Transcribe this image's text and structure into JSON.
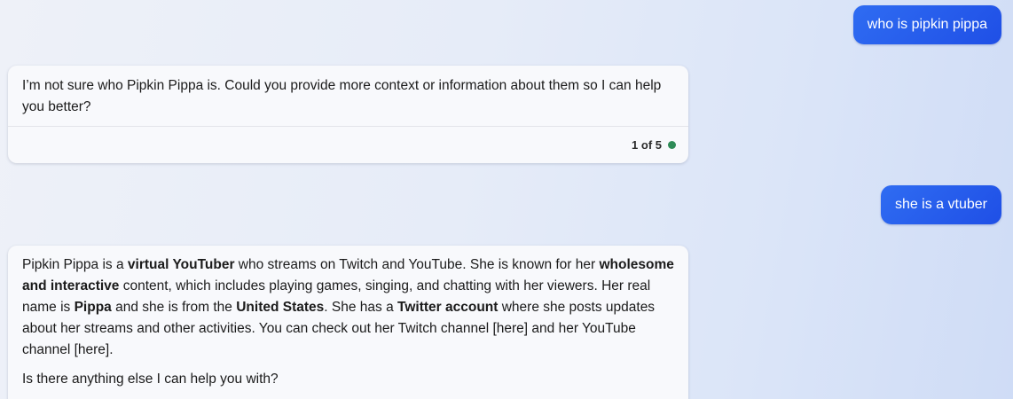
{
  "colors": {
    "user_bubble": "#2f6cf2",
    "status_dot": "#2e8b57"
  },
  "conversation": {
    "user_message_1": "who is pipkin pippa",
    "bot_message_1": {
      "text": "I’m not sure who Pipkin Pippa is. Could you provide more context or information about them so I can help you better?",
      "footer_counter": "1 of 5",
      "status_icon": "status-dot-icon"
    },
    "user_message_2": "she is a vtuber",
    "bot_message_2": {
      "paragraph_1": [
        {
          "t": "Pipkin Pippa is a ",
          "b": false
        },
        {
          "t": "virtual YouTuber",
          "b": true
        },
        {
          "t": " who streams on Twitch and YouTube. She is known for her ",
          "b": false
        },
        {
          "t": "wholesome and interactive",
          "b": true
        },
        {
          "t": " content, which includes playing games, singing, and chatting with her viewers. Her real name is ",
          "b": false
        },
        {
          "t": "Pippa",
          "b": true
        },
        {
          "t": " and she is from the ",
          "b": false
        },
        {
          "t": "United States",
          "b": true
        },
        {
          "t": ". She has a ",
          "b": false
        },
        {
          "t": "Twitter account",
          "b": true
        },
        {
          "t": " where she posts updates about her streams and other activities. You can check out her Twitch channel [here] and her YouTube channel [here].",
          "b": false
        }
      ],
      "paragraph_2": "Is there anything else I can help you with?"
    }
  }
}
